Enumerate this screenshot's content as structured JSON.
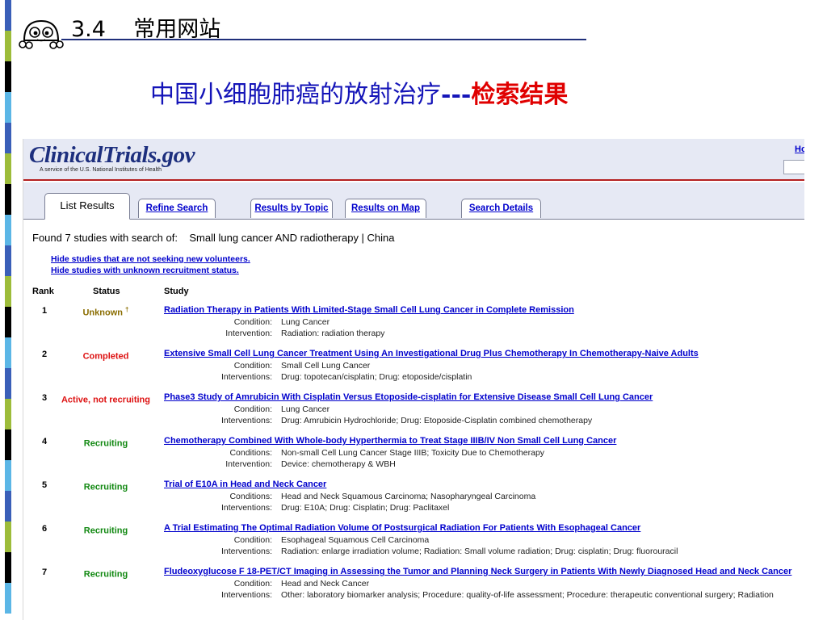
{
  "slide": {
    "section_number": "3.4",
    "section_title": "常用网站",
    "subtitle_main": "中国小细胞肺癌的放射治疗",
    "subtitle_dashes": "---",
    "subtitle_result": "检索结果"
  },
  "site": {
    "logo": "ClinicalTrials.gov",
    "logo_sub": "A service of the U.S. National Institutes of Health",
    "home_link": "Ho"
  },
  "tabs": [
    {
      "label": "List Results"
    },
    {
      "label": "Refine Search"
    },
    {
      "label": "Results by Topic"
    },
    {
      "label": "Results on Map"
    },
    {
      "label": "Search Details"
    }
  ],
  "search": {
    "found_prefix": "Found 7 studies with search of:",
    "query": "Small lung cancer AND radiotherapy | China",
    "hide_not_seeking": "Hide studies that are not seeking new volunteers.",
    "hide_unknown": "Hide studies with unknown recruitment status."
  },
  "table": {
    "headers": [
      "Rank",
      "Status",
      "Study"
    ],
    "rows": [
      {
        "rank": "1",
        "status": "Unknown",
        "status_mark": "†",
        "status_color": "#8a6d00",
        "title": "Radiation Therapy in Patients With Limited-Stage Small Cell Lung Cancer in Complete Remission",
        "label1": "Condition:",
        "value1": "Lung Cancer",
        "label2": "Intervention:",
        "value2": "Radiation: radiation therapy"
      },
      {
        "rank": "2",
        "status": "Completed",
        "status_mark": "",
        "status_color": "#dd1111",
        "title": "Extensive Small Cell Lung Cancer Treatment Using An Investigational Drug Plus Chemotherapy In Chemotherapy-Naive Adults",
        "label1": "Condition:",
        "value1": "Small Cell Lung Cancer",
        "label2": "Interventions:",
        "value2": "Drug: topotecan/cisplatin;   Drug: etoposide/cisplatin"
      },
      {
        "rank": "3",
        "status": "Active, not recruiting",
        "status_mark": "",
        "status_color": "#dd1111",
        "title": "Phase3 Study of Amrubicin With Cisplatin Versus Etoposide-cisplatin for Extensive Disease Small Cell Lung Cancer",
        "label1": "Condition:",
        "value1": "Lung Cancer",
        "label2": "Interventions:",
        "value2": "Drug: Amrubicin Hydrochloride;   Drug: Etoposide-Cisplatin combined chemotherapy"
      },
      {
        "rank": "4",
        "status": "Recruiting",
        "status_mark": "",
        "status_color": "#118811",
        "title": "Chemotherapy Combined With Whole-body Hyperthermia to Treat Stage IIIB/IV Non Small Cell Lung Cancer",
        "label1": "Conditions:",
        "value1": "Non-small Cell Lung Cancer Stage IIIB;   Toxicity Due to Chemotherapy",
        "label2": "Intervention:",
        "value2": "Device: chemotherapy & WBH"
      },
      {
        "rank": "5",
        "status": "Recruiting",
        "status_mark": "",
        "status_color": "#118811",
        "title": "Trial of E10A in Head and Neck Cancer",
        "label1": "Conditions:",
        "value1": "Head and Neck Squamous Carcinoma;   Nasopharyngeal Carcinoma",
        "label2": "Interventions:",
        "value2": "Drug: E10A;   Drug: Cisplatin;   Drug: Paclitaxel"
      },
      {
        "rank": "6",
        "status": "Recruiting",
        "status_mark": "",
        "status_color": "#118811",
        "title": "A Trial Estimating The Optimal Radiation Volume Of Postsurgical Radiation For Patients With Esophageal Cancer",
        "label1": "Condition:",
        "value1": "Esophageal Squamous Cell Carcinoma",
        "label2": "Interventions:",
        "value2": "Radiation: enlarge irradiation volume;   Radiation: Small volume radiation;   Drug: cisplatin;   Drug: fluorouracil"
      },
      {
        "rank": "7",
        "status": "Recruiting",
        "status_mark": "",
        "status_color": "#118811",
        "title": "Fludeoxyglucose F 18-PET/CT Imaging in Assessing the Tumor and Planning Neck Surgery in Patients With Newly Diagnosed Head and Neck Cancer",
        "label1": "Condition:",
        "value1": "Head and Neck Cancer",
        "label2": "Interventions:",
        "value2": "Other: laboratory biomarker analysis;   Procedure: quality-of-life assessment;   Procedure: therapeutic conventional surgery;   Radiation"
      }
    ]
  },
  "colors": {
    "nav_blue": "#1d2f7e",
    "link_blue": "#0000cc",
    "header_bg": "#e6e9f4",
    "accent_red": "#b42020"
  }
}
